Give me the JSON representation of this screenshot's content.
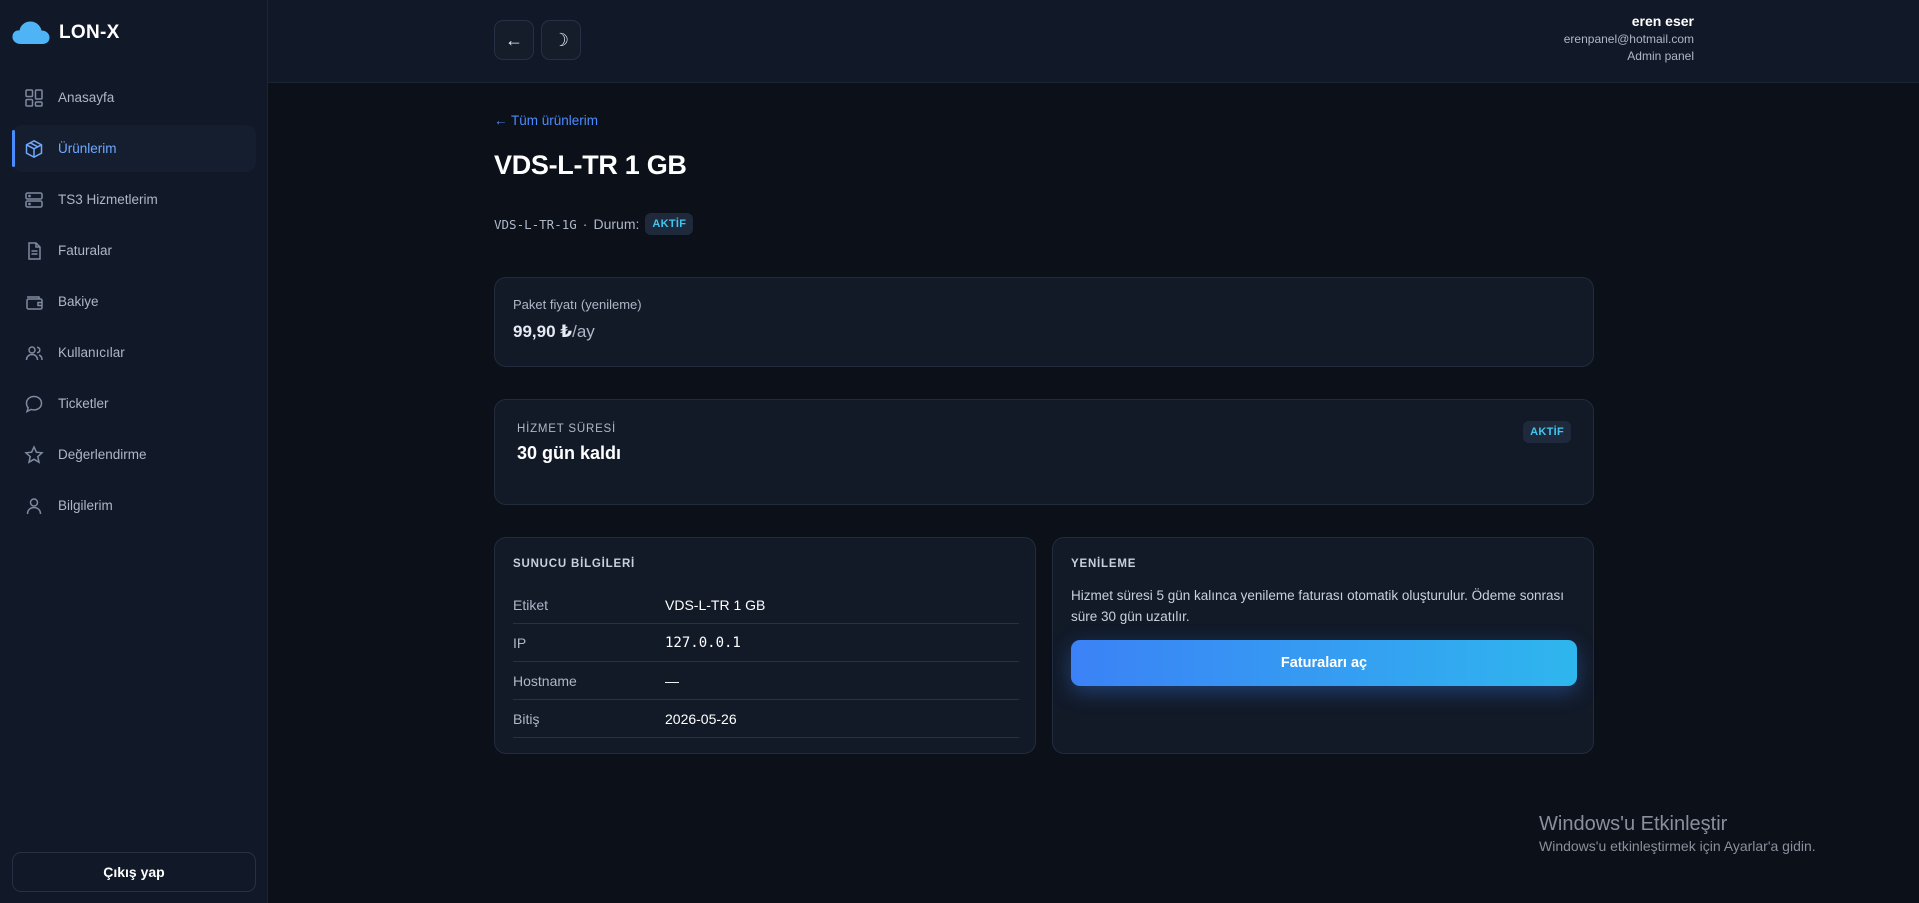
{
  "brand": {
    "name": "LON-X",
    "logo_icon": "cloud-icon",
    "logo_color": "#4fb4f6"
  },
  "sidebar": {
    "items": [
      {
        "label": "Anasayfa",
        "icon": "dashboard-grid-icon"
      },
      {
        "label": "Ürünlerim",
        "icon": "box-icon",
        "active": true
      },
      {
        "label": "TS3 Hizmetlerim",
        "icon": "server-icon"
      },
      {
        "label": "Faturalar",
        "icon": "document-icon"
      },
      {
        "label": "Bakiye",
        "icon": "wallet-icon"
      },
      {
        "label": "Kullanıcılar",
        "icon": "users-icon"
      },
      {
        "label": "Ticketler",
        "icon": "chat-bubble-icon"
      },
      {
        "label": "Değerlendirme",
        "icon": "star-icon"
      },
      {
        "label": "Bilgilerim",
        "icon": "user-icon"
      }
    ],
    "logout_label": "Çıkış yap"
  },
  "topbar": {
    "back_icon": "←",
    "theme_icon": "☽",
    "user": {
      "name": "eren eser",
      "email": "erenpanel@hotmail.com",
      "role": "Admin panel"
    }
  },
  "page": {
    "back_link": "← Tüm ürünlerim",
    "title": "VDS-L-TR 1 GB",
    "code": "VDS-L-TR-1G",
    "separator": "·",
    "status_label": "Durum:",
    "status_badge": "AKTİF"
  },
  "price_card": {
    "label": "Paket fiyatı (yenileme)",
    "amount": "99,90 ₺",
    "period": "/ay"
  },
  "service_card": {
    "label": "HİZMET SÜRESİ",
    "remaining": "30 gün kaldı",
    "badge": "AKTİF"
  },
  "server_info": {
    "title": "SUNUCU BİLGİLERİ",
    "rows": [
      {
        "key": "Etiket",
        "value": "VDS-L-TR 1 GB"
      },
      {
        "key": "IP",
        "value": "127.0.0.1"
      },
      {
        "key": "Hostname",
        "value": "—"
      },
      {
        "key": "Bitiş",
        "value": "2026-05-26"
      }
    ]
  },
  "renewal": {
    "title": "YENİLEME",
    "text": "Hizmet süresi 5 gün kalınca yenileme faturası otomatik oluşturulur. Ödeme sonrası süre 30 gün uzatılır.",
    "button_label": "Faturaları aç"
  },
  "watermark": {
    "title": "Windows'u Etkinleştir",
    "subtitle": "Windows'u etkinleştirmek için Ayarlar'a gidin."
  },
  "colors": {
    "accent": "#4a8cff",
    "badge_text": "#3fc6f0",
    "background": "#0b1019",
    "card": "#121a28"
  }
}
